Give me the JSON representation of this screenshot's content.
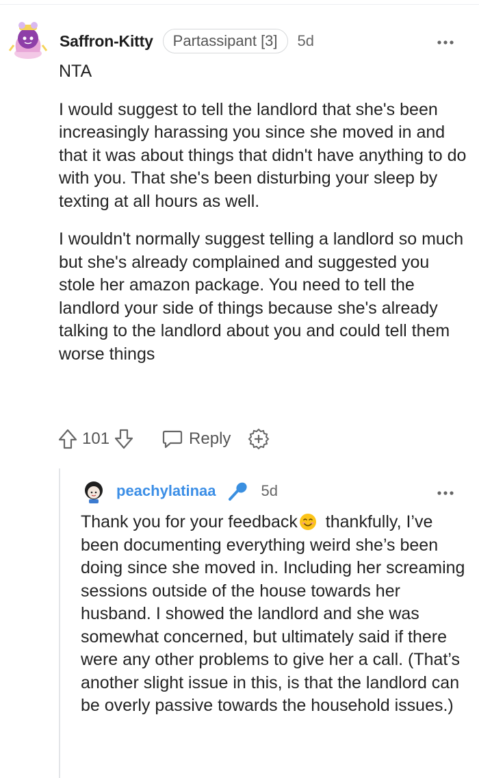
{
  "comment": {
    "author": "Saffron-Kitty",
    "flair": "Partassipant [3]",
    "age": "5d",
    "more_icon": "more-horizontal-icon",
    "paragraphs": [
      "NTA",
      "I would suggest to tell the landlord that she's been increasingly harassing you since she moved in and that it was about things that didn't have anything to do with you. That she's been disturbing your sleep by texting at all hours as well.",
      "I wouldn't normally suggest telling a landlord so much but she's already complained and suggested you stole her amazon package. You need to tell the landlord your side of things because she's already talking to the landlord about you and could tell them worse things"
    ],
    "score": "101",
    "reply_label": "Reply"
  },
  "reply": {
    "author": "peachylatinaa",
    "age": "5d",
    "author_color": "#3b8ee6",
    "text_before_emoji": "Thank you for your feedback",
    "emoji": "smiling-face-emoji",
    "text_after_emoji": " thankfully, I’ve been documenting everything weird she’s been doing since she moved in. Including her screaming sessions outside of the house towards her husband. I showed the landlord and she was somewhat concerned, but ultimately said if there were any other problems to give her a call. (That’s another slight issue in this, is that the landlord can be overly passive towards the household issues.)"
  }
}
